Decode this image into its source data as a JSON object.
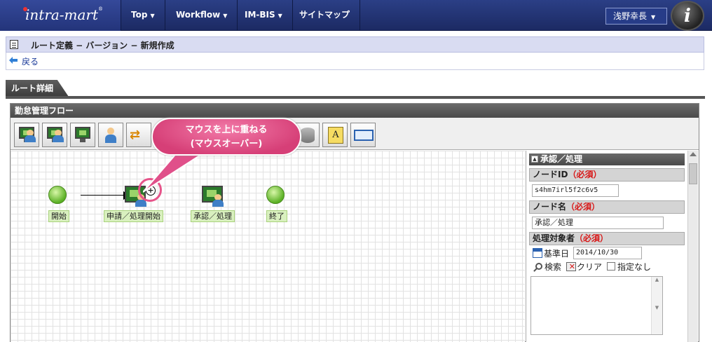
{
  "header": {
    "logo": "intra-mart",
    "logo_mark": "®",
    "nav": [
      {
        "label": "Top"
      },
      {
        "label": "Workflow"
      },
      {
        "label": "IM-BIS"
      },
      {
        "label": "サイトマップ"
      }
    ],
    "user": "浅野幸長"
  },
  "page": {
    "title": "ルート定義 − バージョン − 新規作成",
    "back_label": "戻る",
    "tab_label": "ルート詳細"
  },
  "flow": {
    "title": "勤怠管理フロー",
    "nodes": [
      {
        "label": "開始"
      },
      {
        "label": "申請／処理開始"
      },
      {
        "label": "承認／処理"
      },
      {
        "label": "終了"
      }
    ]
  },
  "callout": {
    "line1": "マウスを上に重ねる",
    "line2": "(マウスオーバー)"
  },
  "side_panel": {
    "title": "承認／処理",
    "required_mark": "（必須）",
    "node_id_label": "ノードID",
    "node_id_value": "s4hm7irl5f2c6v5",
    "node_name_label": "ノード名",
    "node_name_value": "承認／処理",
    "target_label": "処理対象者",
    "base_date_label": "基準日",
    "base_date_value": "2014/10/30",
    "search_label": "検索",
    "clear_label": "クリア",
    "unspecified_label": "指定なし"
  },
  "colors": {
    "header_bg": "#1c2a63",
    "title_bg": "#d9dcf2",
    "callout": "#e0508a",
    "node_green": "#5ab024",
    "required": "#d81818"
  }
}
